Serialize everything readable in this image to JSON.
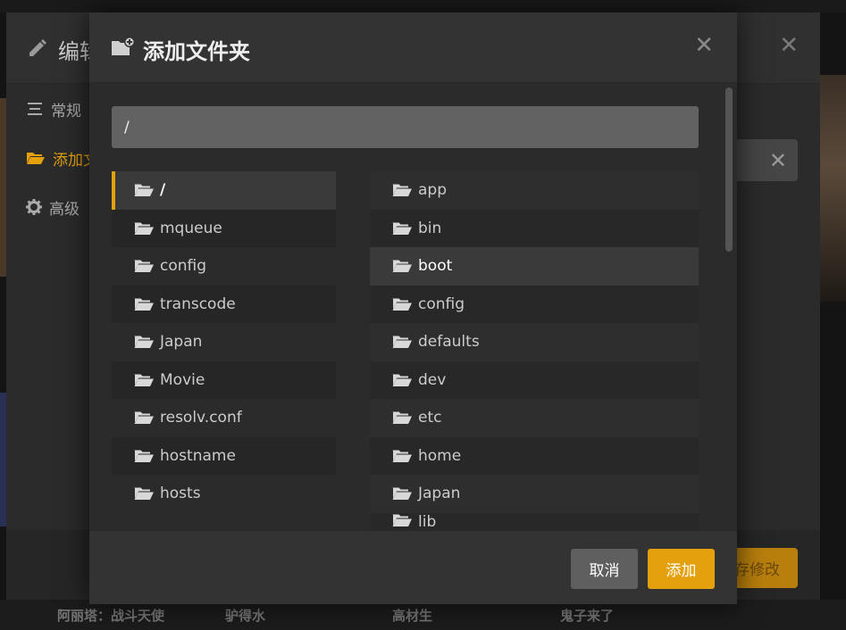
{
  "background": {
    "bottom_titles": [
      "阿丽塔：战斗天使",
      "驴得水",
      "高材生",
      "鬼子来了"
    ]
  },
  "edit_dialog": {
    "title": "编辑",
    "nav": [
      {
        "label": "常规",
        "icon": "list-icon"
      },
      {
        "label": "添加文",
        "icon": "folder-open-icon"
      },
      {
        "label": "高级",
        "icon": "gear-icon"
      }
    ],
    "save_label": "存修改",
    "close_glyph": "✕"
  },
  "add_folder": {
    "title": "添加文件夹",
    "close_glyph": "✕",
    "path_value": "/",
    "left_column": [
      "/",
      "mqueue",
      "config",
      "transcode",
      "Japan",
      "Movie",
      "resolv.conf",
      "hostname",
      "hosts"
    ],
    "right_column": [
      "app",
      "bin",
      "boot",
      "config",
      "defaults",
      "dev",
      "etc",
      "home",
      "Japan",
      "lib"
    ],
    "cancel_label": "取消",
    "add_label": "添加"
  },
  "colors": {
    "accent": "#e5a00d",
    "modal_bg": "#2b2b2b",
    "input_bg": "#626262"
  }
}
